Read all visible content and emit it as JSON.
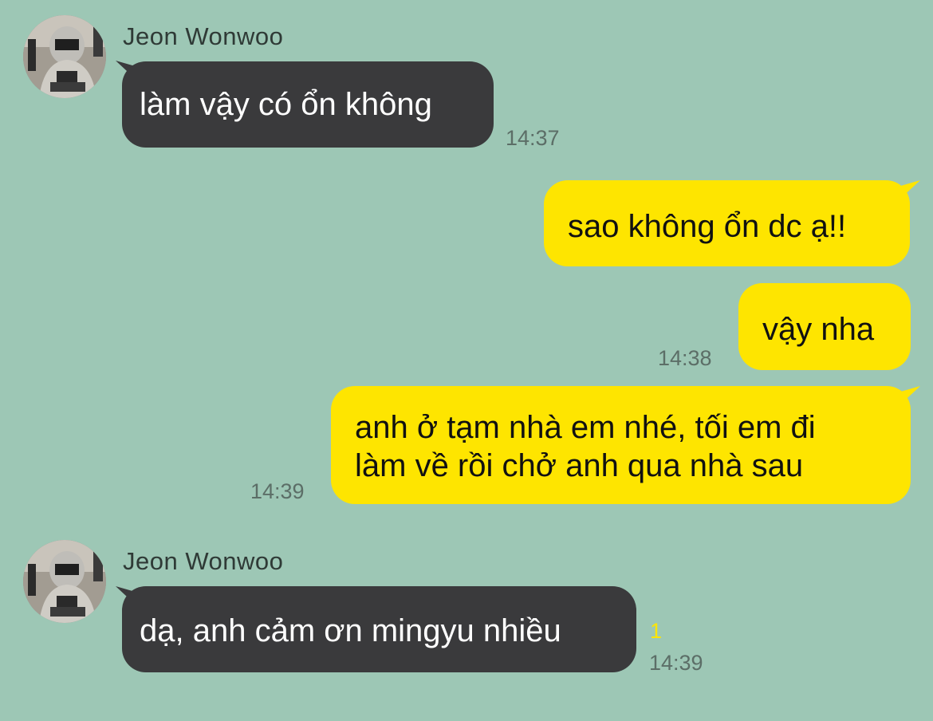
{
  "chat": {
    "contact_name": "Jeon Wonwoo",
    "accent_incoming": "#3a3a3c",
    "accent_outgoing": "#fee500",
    "background": "#9dc7b5",
    "messages": [
      {
        "side": "in",
        "text": "làm vậy có ổn không",
        "time": "14:37"
      },
      {
        "side": "out",
        "text": "sao không ổn dc ạ!!",
        "time": ""
      },
      {
        "side": "out",
        "text": "vậy nha",
        "time": "14:38"
      },
      {
        "side": "out",
        "lines": [
          "anh ở tạm nhà em nhé, tối em đi",
          "làm về rồi chở anh qua nhà sau"
        ],
        "time": "14:39"
      },
      {
        "side": "in",
        "text": "dạ, anh cảm ơn mingyu nhiều",
        "time": "14:39",
        "unread": "1"
      }
    ]
  }
}
